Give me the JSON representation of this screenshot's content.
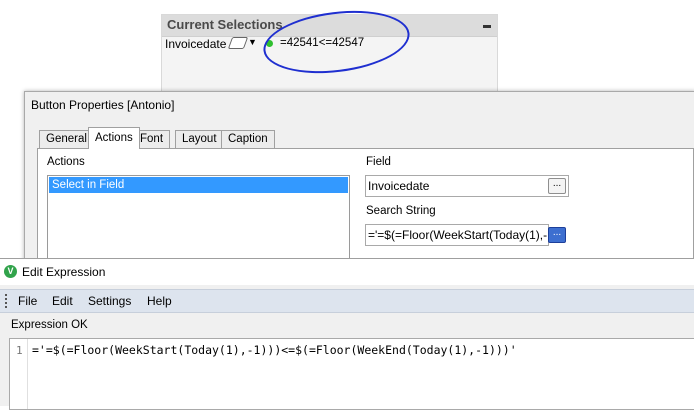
{
  "current_selections": {
    "title": "Current Selections",
    "field": "Invoicedate",
    "value": "=42541<=42547",
    "status_color": "#2fbf2f"
  },
  "button_properties": {
    "title": "Button Properties [Antonio]",
    "tabs": [
      {
        "label": "General",
        "active": false
      },
      {
        "label": "Actions",
        "active": true
      },
      {
        "label": "Font",
        "active": false
      },
      {
        "label": "Layout",
        "active": false
      },
      {
        "label": "Caption",
        "active": false
      }
    ],
    "actions_label": "Actions",
    "actions_list": [
      "Select in Field"
    ],
    "field_label": "Field",
    "field_value": "Invoicedate",
    "search_label": "Search String",
    "search_value": "='=$(=Floor(WeekStart(Today(1),-1)))<=$(=Floor(WeekEnd(Today(1),-1)))'",
    "browse_button": "..."
  },
  "edit_expression": {
    "title": "Edit Expression",
    "logo": "V",
    "menu": [
      "File",
      "Edit",
      "Settings",
      "Help"
    ],
    "status": "Expression OK",
    "line_number": "1",
    "code": "='=$(=Floor(WeekStart(Today(1),-1)))<=$(=Floor(WeekEnd(Today(1),-1)))'"
  }
}
